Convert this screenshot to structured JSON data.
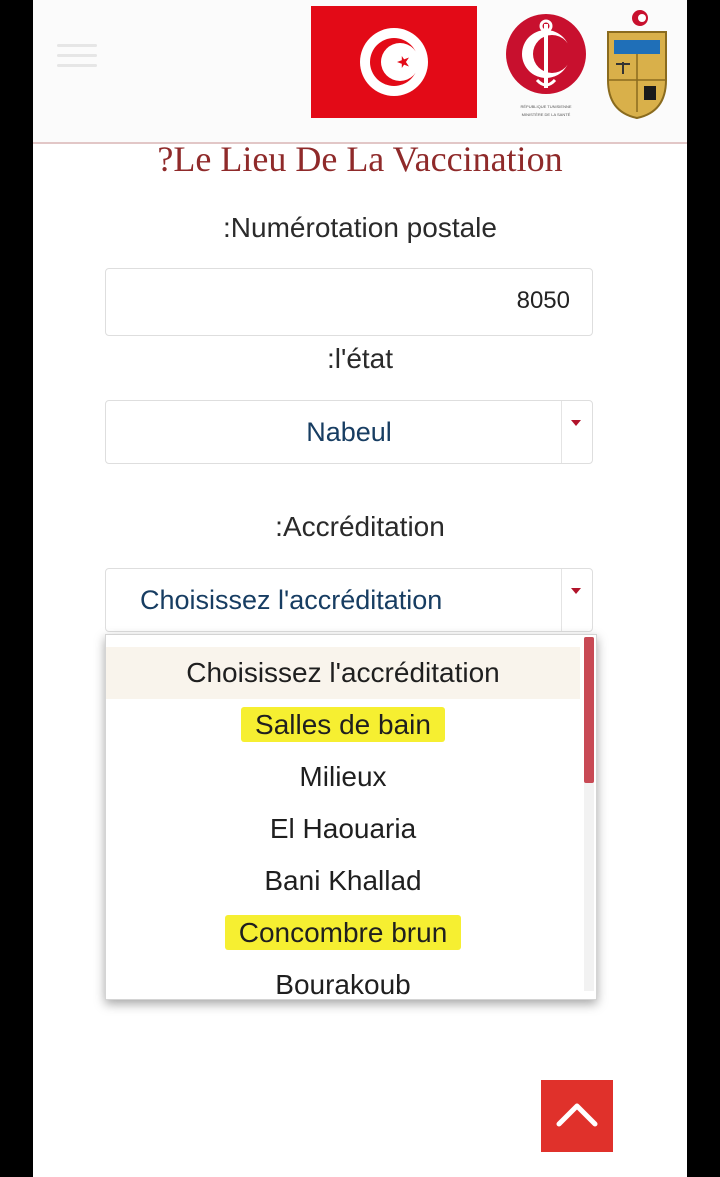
{
  "header": {
    "menu_icon": "hamburger-menu-icon",
    "ministry_text_line1": "RÉPUBLIQUE TUNISIENNE",
    "ministry_text_line2": "MINISTÈRE DE LA SANTÉ",
    "colors": {
      "flag_red": "#e30a17",
      "accent_red": "#c8102e"
    }
  },
  "title": "?Le Lieu De La Vaccination",
  "postal": {
    "label": ":Numérotation postale",
    "value": "8050"
  },
  "state": {
    "label": ":l'état",
    "value": "Nabeul"
  },
  "accreditation": {
    "label": ":Accréditation",
    "value": "Choisissez l'accréditation",
    "options": [
      {
        "text": "Choisissez l'accréditation",
        "selected": true,
        "highlighted": false
      },
      {
        "text": "Salles de bain",
        "selected": false,
        "highlighted": true
      },
      {
        "text": "Milieux",
        "selected": false,
        "highlighted": false
      },
      {
        "text": "El Haouaria",
        "selected": false,
        "highlighted": false
      },
      {
        "text": "Bani Khallad",
        "selected": false,
        "highlighted": false
      },
      {
        "text": "Concombre brun",
        "selected": false,
        "highlighted": true
      },
      {
        "text": "Bourakoub",
        "selected": false,
        "highlighted": false
      }
    ]
  },
  "colors": {
    "title": "#8f2a2a",
    "select_text": "#173d62",
    "highlight": "#f6ef31",
    "back_to_top": "#e0312b",
    "scroll_thumb": "#c84a55"
  },
  "icons": {
    "caret": "caret-down-icon",
    "back_to_top": "chevron-up-icon"
  }
}
